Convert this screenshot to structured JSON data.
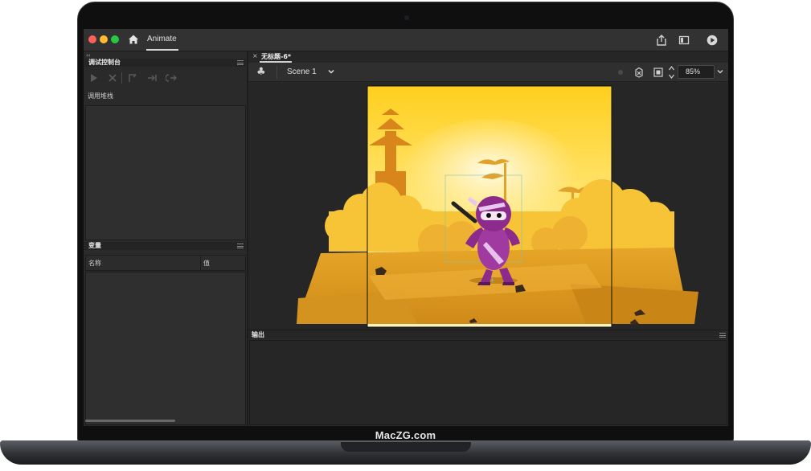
{
  "app": {
    "name": "Animate",
    "brand_caption": "MacZG.com"
  },
  "left_panel": {
    "collapse_glyph": "‹‹",
    "debug_console": {
      "title": "调试控制台",
      "tools": [
        "play-icon",
        "stop-icon",
        "step-in-icon",
        "step-over-icon",
        "step-out-icon"
      ],
      "call_stack_label": "调用堆栈"
    },
    "variables": {
      "title": "变量",
      "columns": [
        "名称",
        "值"
      ]
    }
  },
  "document": {
    "tab_close": "×",
    "tab_title": "无标题-6*",
    "scene_name": "Scene 1",
    "zoom": "85%"
  },
  "output_panel": {
    "title": "输出"
  },
  "colors": {
    "accent_play": "#d8d8d8",
    "stage_sky_top": "#ffd21f",
    "stage_sky_bottom": "#fff6c9",
    "ground": "#d89622",
    "ninja": "#8c2b8b"
  }
}
